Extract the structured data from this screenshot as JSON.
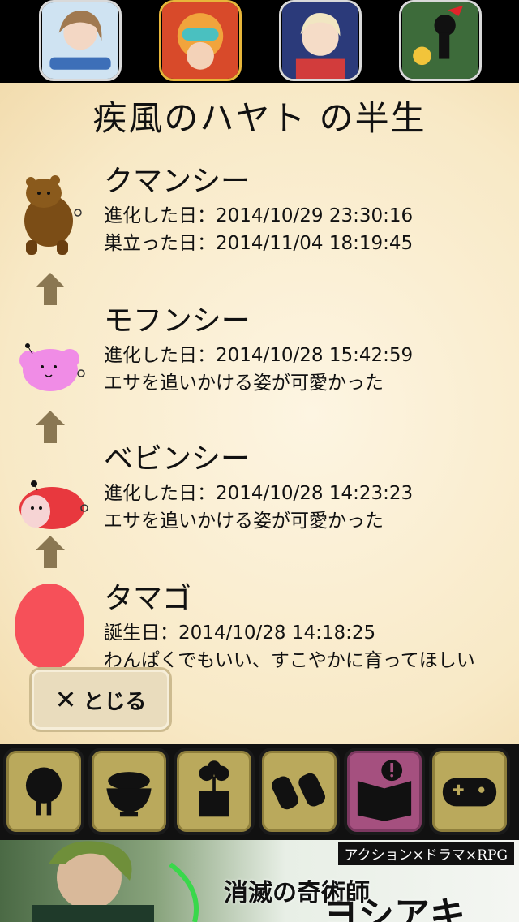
{
  "title": "疾風のハヤト の半生",
  "stages": [
    {
      "name": "クマンシー",
      "line1": "進化した日：2014/10/29  23:30:16",
      "line2": "巣立った日：2014/11/04  18:19:45",
      "creature_icon": "bear-creature-icon"
    },
    {
      "name": "モフンシー",
      "line1": "進化した日：2014/10/28  15:42:59",
      "line2": "エサを追いかける姿が可愛かった",
      "creature_icon": "pink-fluffy-creature-icon"
    },
    {
      "name": "ベビンシー",
      "line1": "進化した日：2014/10/28  14:23:23",
      "line2": "エサを追いかける姿が可愛かった",
      "creature_icon": "baby-creature-icon"
    },
    {
      "name": "タマゴ",
      "line1": "誕生日：2014/10/28  14:18:25",
      "line2": "わんぱくでもいい、すこやかに育ってほしい",
      "creature_icon": "red-egg-icon"
    }
  ],
  "close_button": {
    "x": "✕",
    "label": "とじる"
  },
  "nav": [
    "character-icon",
    "rice-bowl-icon",
    "sprout-pot-icon",
    "binoculars-icon",
    "book-alert-icon",
    "gamepad-icon"
  ],
  "banner": {
    "tag": "アクション×ドラマ×RPG",
    "title1": "消滅の奇術師",
    "title2": "ヨシアキ"
  },
  "colors": {
    "panel_bg": "#f8e9c6",
    "nav_button": "#baa95c",
    "nav_button_active": "#a5507f",
    "arrow": "#8a7752"
  }
}
